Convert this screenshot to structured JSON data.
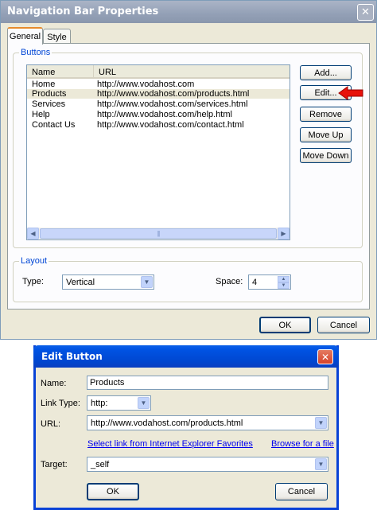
{
  "nav_props": {
    "title": "Navigation Bar Properties",
    "close_glyph": "✕",
    "tabs": [
      {
        "label": "General",
        "active": true
      },
      {
        "label": "Style",
        "active": false
      }
    ],
    "buttons_group": {
      "legend": "Buttons",
      "columns": [
        "Name",
        "URL"
      ],
      "rows": [
        {
          "name": "Home",
          "url": "http://www.vodahost.com"
        },
        {
          "name": "Products",
          "url": "http://www.vodahost.com/products.html",
          "selected": true
        },
        {
          "name": "Services",
          "url": "http://www.vodahost.com/services.html"
        },
        {
          "name": "Help",
          "url": "http://www.vodahost.com/help.html"
        },
        {
          "name": "Contact Us",
          "url": "http://www.vodahost.com/contact.html"
        }
      ]
    },
    "actions": {
      "add": "Add...",
      "edit": "Edit...",
      "remove": "Remove",
      "move_up": "Move Up",
      "move_down": "Move Down"
    },
    "layout_group": {
      "legend": "Layout",
      "type_label": "Type:",
      "type_value": "Vertical",
      "space_label": "Space:",
      "space_value": "4"
    },
    "ok": "OK",
    "cancel": "Cancel"
  },
  "edit_button": {
    "title": "Edit Button",
    "close_glyph": "✕",
    "name_label": "Name:",
    "name_value": "Products",
    "link_type_label": "Link Type:",
    "link_type_value": "http:",
    "url_label": "URL:",
    "url_value": "http://www.vodahost.com/products.html",
    "favorites_link": "Select link from Internet Explorer Favorites",
    "browse_link": "Browse for a file",
    "target_label": "Target:",
    "target_value": "_self",
    "ok": "OK",
    "cancel": "Cancel"
  },
  "icons": {
    "dropdown": "chevron-down-icon",
    "pointer": "red-arrow-icon",
    "scroll_left": "arrow-left-icon",
    "scroll_right": "arrow-right-icon"
  },
  "colors": {
    "active_titlebar": "#0a5fe8",
    "inactive_titlebar": "#93a0b6",
    "pointer_arrow": "#e8120c",
    "link": "#0000ee",
    "group_legend": "#0046d5"
  }
}
